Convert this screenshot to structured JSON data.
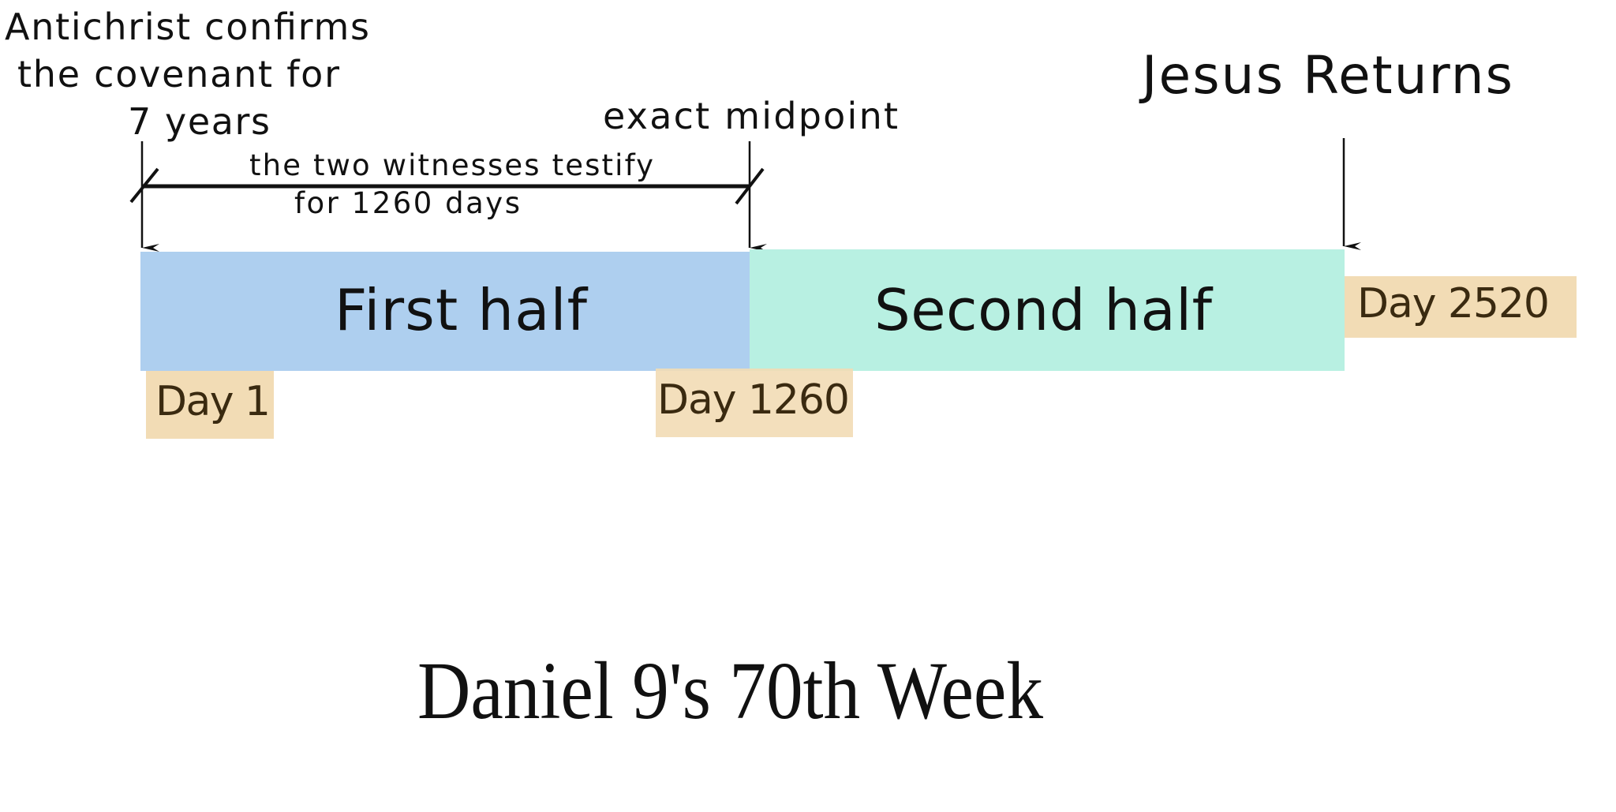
{
  "annotations": {
    "start_line1": "Antichrist confirms",
    "start_line2": "the covenant for",
    "start_line3": "7 years",
    "midpoint": "exact midpoint",
    "end": "Jesus Returns",
    "witnesses_line1": "the two witnesses testify",
    "witnesses_line2": "for 1260 days"
  },
  "segments": [
    {
      "label": "First half",
      "color": "#aecfef"
    },
    {
      "label": "Second half",
      "color": "#b8f0e2"
    }
  ],
  "day_markers": [
    {
      "label": "Day 1",
      "color": "#f2dcb5"
    },
    {
      "label": "Day 1260",
      "color": "#f2dcb5"
    },
    {
      "label": "Day 2520",
      "color": "#f2dcb5"
    }
  ],
  "title": "Daniel 9's 70th Week"
}
